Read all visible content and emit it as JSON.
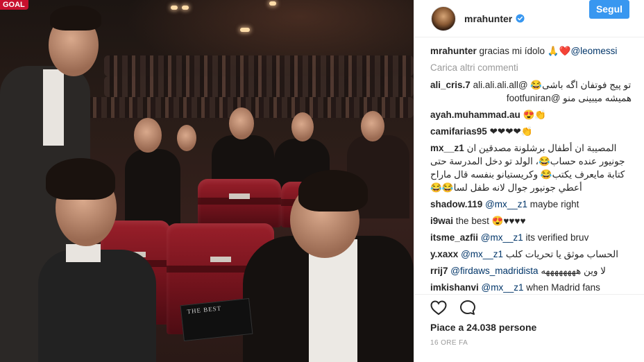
{
  "photo": {
    "watermark": "GOAL",
    "book_title": "THE BEST"
  },
  "header": {
    "username": "mrahunter",
    "follow_label": "Segul",
    "accent_color": "#3897f0"
  },
  "caption": {
    "user": "mrahunter",
    "text": " gracias mi ídolo 🙏❤️",
    "mention": "@leomessi"
  },
  "load_more_label": "Carica altri commenti",
  "comments": [
    {
      "user": "ali_cris.7",
      "body": "تو پیج فوتفان اگه باشی😂 @ali.ali.ali.all",
      "rtl": true
    },
    {
      "user": "",
      "body": "همیشه میبینی منو @footfuniran",
      "rtl": true
    },
    {
      "user": "ayah.muhammad.au",
      "body": "😍👏",
      "rtl": false
    },
    {
      "user": "camifarias95",
      "body": "❤❤❤❤👏",
      "rtl": false
    },
    {
      "user": "mx__z1",
      "body": "المصيبة ان أطفال برشلونة مصدقين ان جونيور عنده حساب😂، الولد تو دخل المدرسة حتى كتابة مايعرف يكتب😂 وكريستيانو بنفسه قال ماراح أعطي جونيور جوال لانه طفل لسا😂😂",
      "rtl": true
    },
    {
      "user": "shadow.119",
      "mention": "@mx__z1",
      "body": " maybe right",
      "rtl": false
    },
    {
      "user": "i9wai",
      "body": "the best 😍♥♥♥♥",
      "rtl": false
    },
    {
      "user": "itsme_azfii",
      "mention": "@mx__z1",
      "body": " its verified bruv",
      "rtl": false
    },
    {
      "user": "y.xaxx",
      "mention": "@mx__z1",
      "body": " الحساب موثق يا تحريات كلب",
      "rtl": false
    },
    {
      "user": "rrij7",
      "mention": "@firdaws_madridista",
      "body": " لا وين ههههههههه",
      "rtl": false
    },
    {
      "user": "imkishanvi",
      "mention": "@mx__z1",
      "body": " when Madrid fans",
      "rtl": false
    }
  ],
  "actions": {
    "like_icon": "heart-icon",
    "comment_icon": "comment-icon",
    "likes_text": "Piace a 24.038 persone",
    "timestamp": "16 ORE FA"
  }
}
